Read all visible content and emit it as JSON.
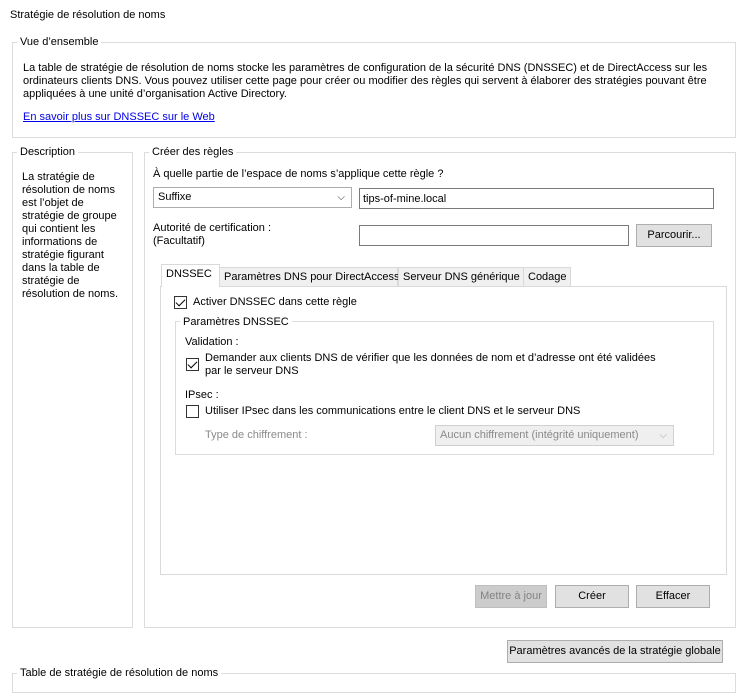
{
  "page_title": "Stratégie de résolution de noms",
  "overview": {
    "title": "Vue d’ensemble",
    "text_line1": "La table de stratégie de résolution de noms stocke les paramètres de configuration de la sécurité DNS (DNSSEC) et de DirectAccess sur les",
    "text_line2": "ordinateurs clients DNS. Vous pouvez utiliser cette page pour créer ou modifier des règles qui servent à élaborer des stratégies pouvant être",
    "text_line3": "appliquées à une unité d’organisation Active Directory.",
    "link": "En savoir plus sur DNSSEC sur le Web"
  },
  "description": {
    "title": "Description",
    "lines": [
      "La stratégie de",
      "résolution de noms",
      "est l’objet de",
      "stratégie de groupe",
      "qui contient les",
      "informations de",
      "stratégie figurant",
      "dans la table de",
      "stratégie de",
      "résolution de noms."
    ]
  },
  "create_rules": {
    "title": "Créer des règles",
    "question": "À quelle partie de l’espace de noms s’applique cette règle ?",
    "scope_select": "Suffixe",
    "scope_value": "tips-of-mine.local",
    "cert_label_1": "Autorité de certification :",
    "cert_label_2": "(Facultatif)",
    "cert_value": "",
    "browse_button": "Parcourir..."
  },
  "tabs": [
    "DNSSEC",
    "Paramètres DNS pour DirectAccess",
    "Serveur DNS générique",
    "Codage"
  ],
  "dnssec": {
    "enable_label": "Activer DNSSEC dans cette règle",
    "enable_checked": true,
    "params_title": "Paramètres DNSSEC",
    "validation_title": "Validation :",
    "validate_label_1": "Demander aux clients DNS de vérifier que les données de nom et d’adresse ont été validées",
    "validate_label_2": "par le serveur DNS",
    "validate_checked": true,
    "ipsec_title": "IPsec :",
    "ipsec_label": "Utiliser IPsec dans les communications entre le client DNS et le serveur DNS",
    "ipsec_checked": false,
    "encryption_label": "Type de chiffrement :",
    "encryption_value": "Aucun chiffrement (intégrité uniquement)"
  },
  "buttons": {
    "update": "Mettre à jour",
    "create": "Créer",
    "clear": "Effacer",
    "advanced": "Paramètres avancés de la stratégie globale"
  },
  "bottom_group_title": "Table de stratégie de résolution de noms"
}
